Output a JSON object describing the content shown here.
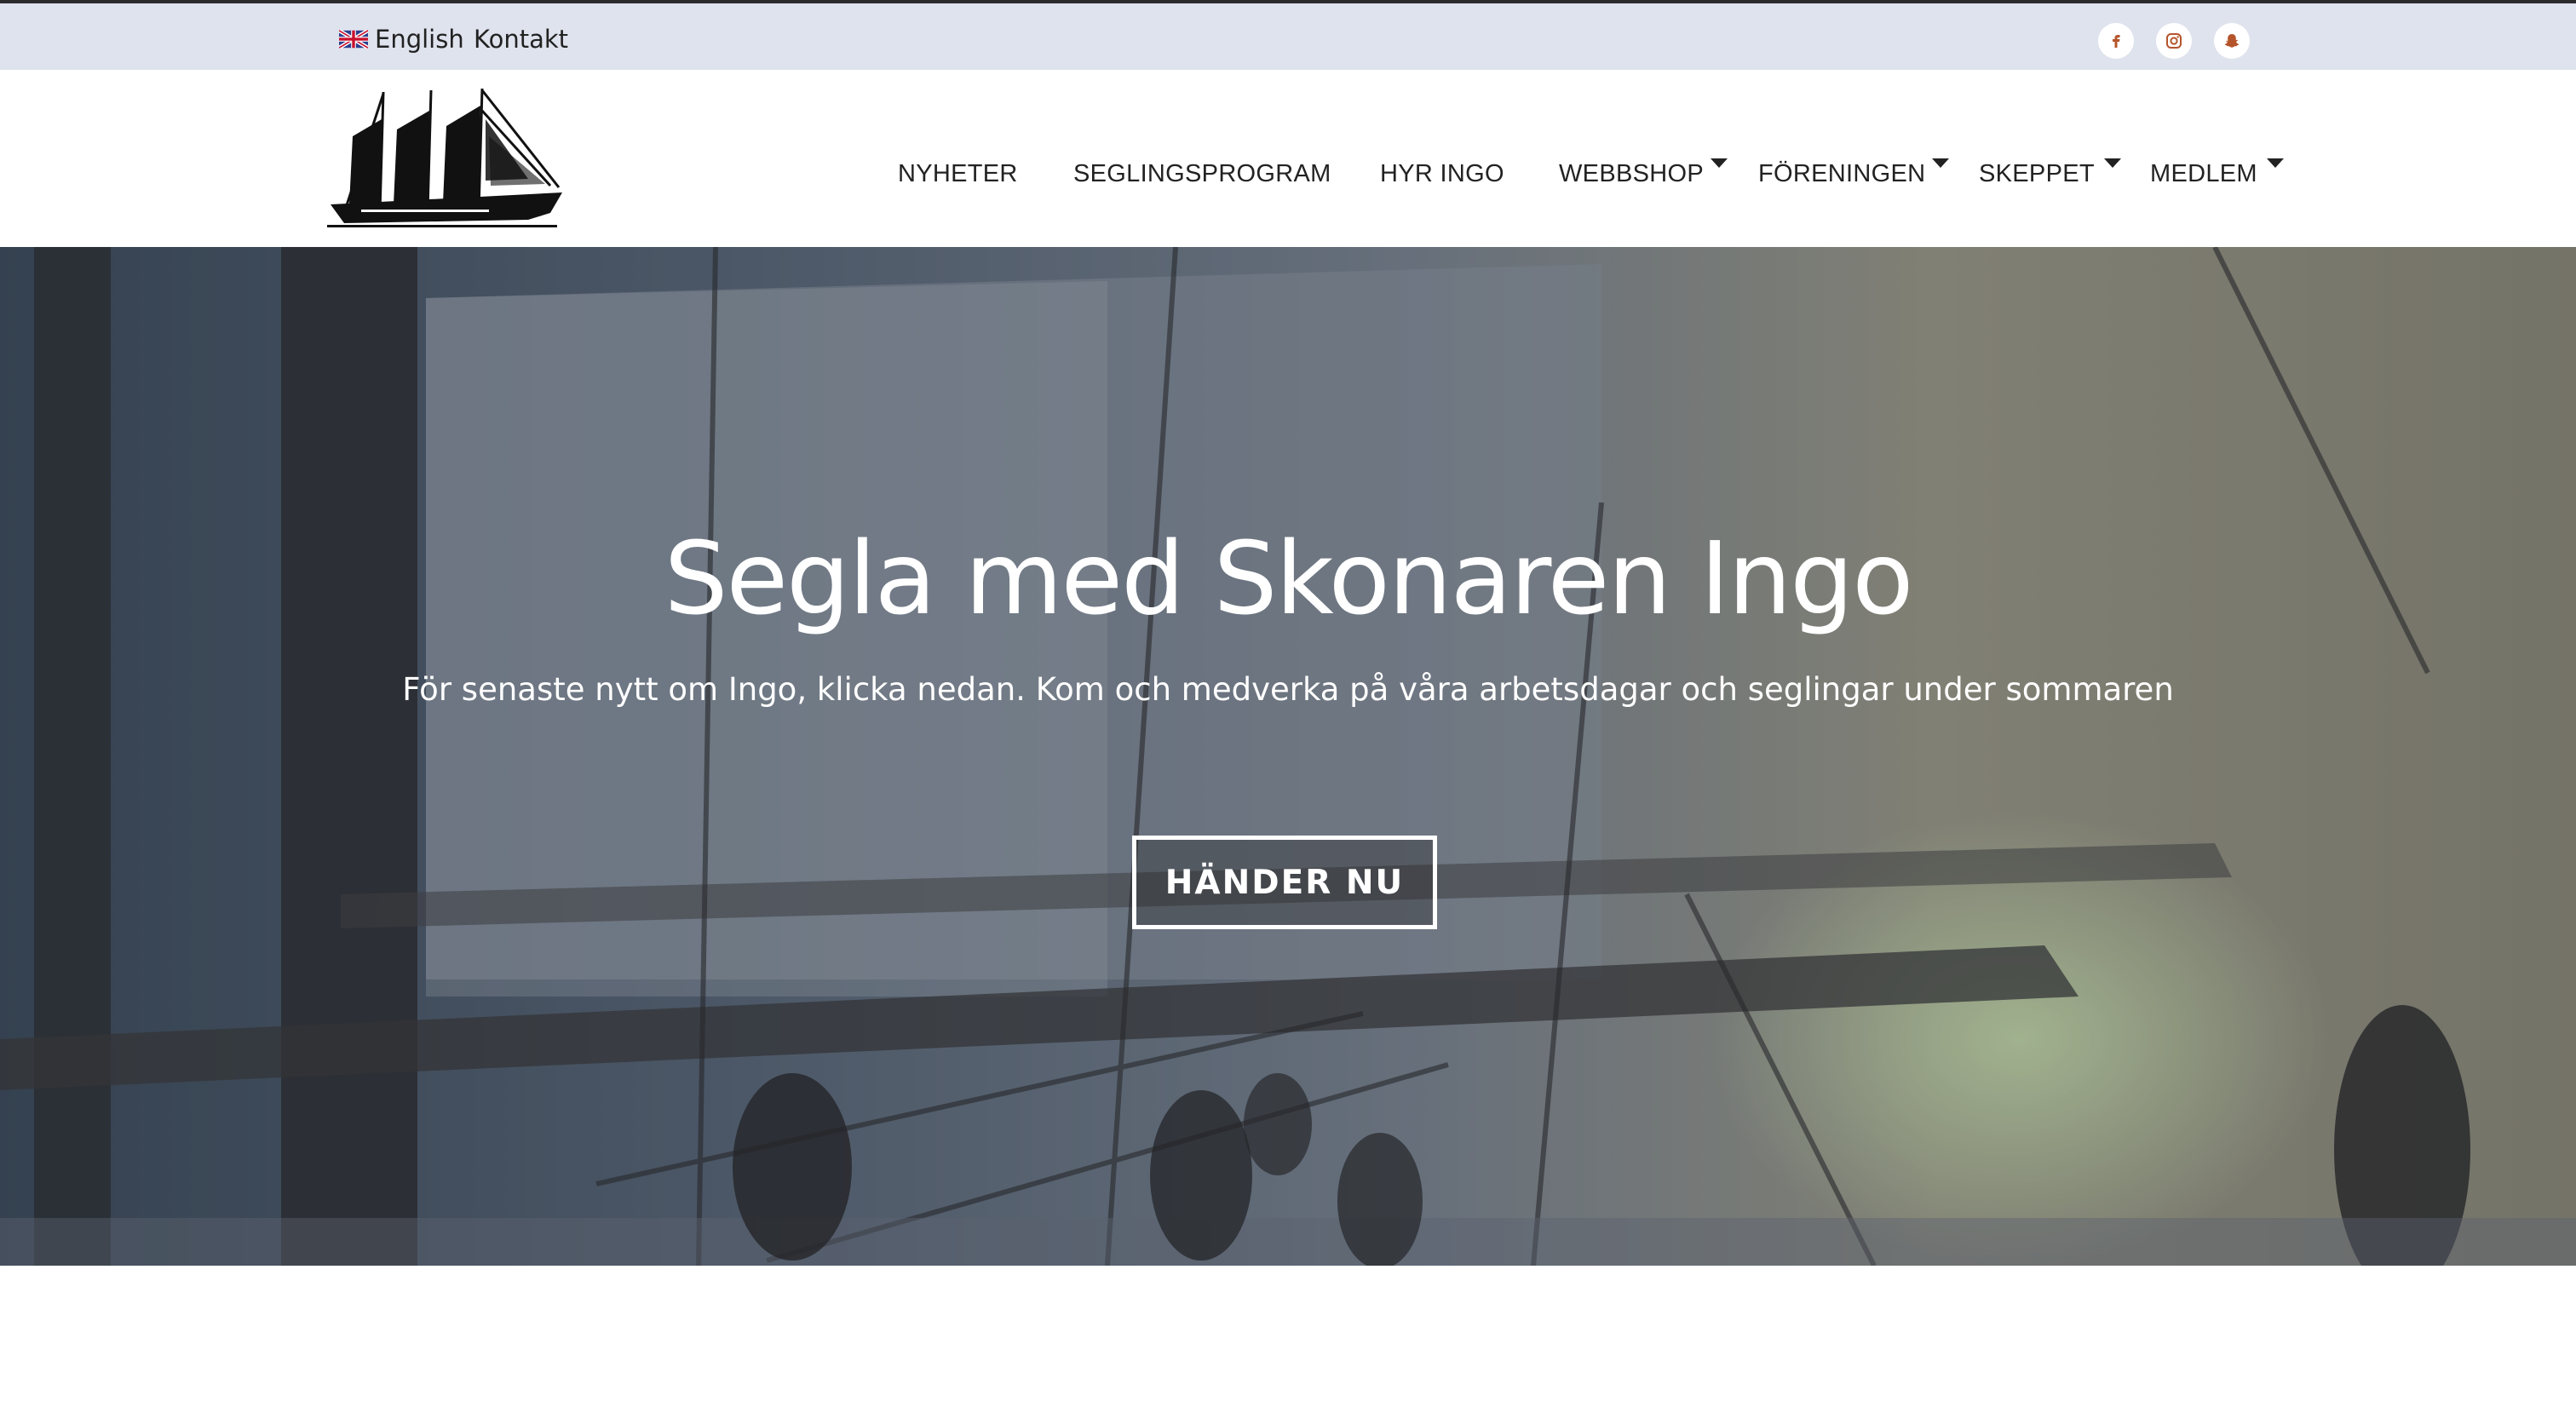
{
  "topbar": {
    "language_label": "English",
    "contact_label": "Kontakt",
    "social": [
      {
        "icon": "facebook-icon"
      },
      {
        "icon": "instagram-icon"
      },
      {
        "icon": "snapchat-icon"
      }
    ],
    "social_icon_color": "#b5542a"
  },
  "nav": {
    "items": [
      {
        "label": "NYHETER",
        "dropdown": false
      },
      {
        "label": "SEGLINGSPROGRAM",
        "dropdown": false
      },
      {
        "label": "HYR INGO",
        "dropdown": false
      },
      {
        "label": "WEBBSHOP",
        "dropdown": true
      },
      {
        "label": "FÖRENINGEN",
        "dropdown": true
      },
      {
        "label": "SKEPPET",
        "dropdown": true
      },
      {
        "label": "MEDLEM",
        "dropdown": true
      }
    ]
  },
  "hero": {
    "title": "Segla med Skonaren Ingo",
    "subtitle": "För senaste nytt om Ingo, klicka nedan. Kom och medverka på våra arbetsdagar och seglingar under sommaren",
    "button_label": "HÄNDER NU"
  },
  "colors": {
    "topbar_bg": "#dfe3ee",
    "header_bg": "#ffffff",
    "text_dark": "#222222",
    "hero_text": "#ffffff"
  }
}
